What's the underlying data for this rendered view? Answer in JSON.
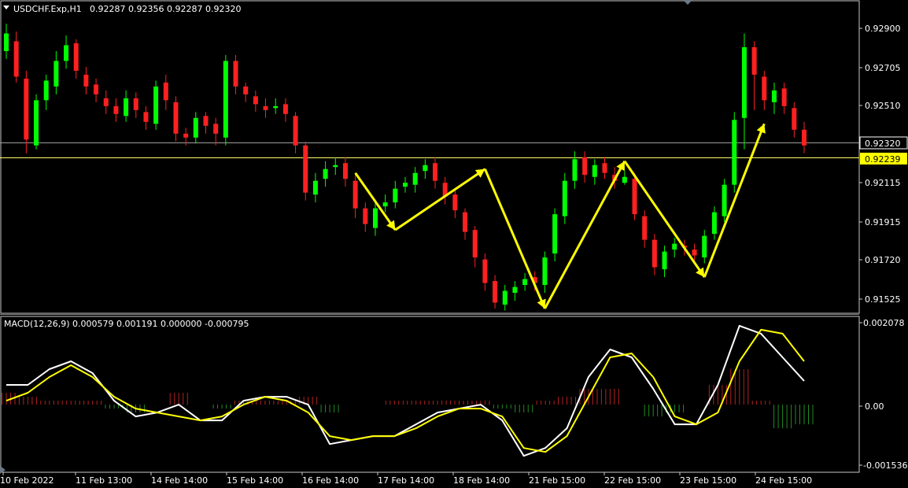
{
  "main_panel": {
    "symbol_label": "USDCHF.Exp,H1",
    "ohlc_label": "0.92287 0.92356 0.92287 0.92320",
    "price_ticks": [
      "0.92900",
      "0.92705",
      "0.92510",
      "0.92320",
      "0.92239",
      "0.92115",
      "0.91915",
      "0.91720",
      "0.91525"
    ],
    "current_price": "0.92320",
    "horizontal_line_price": "0.92239"
  },
  "macd_panel": {
    "indicator_label": "MACD(12,26,9) 0.000579 0.001191 0.000000 -0.000795",
    "scale_ticks": [
      "0.002078",
      "0.00",
      "-0.001536"
    ]
  },
  "time_axis": {
    "labels": [
      "10 Feb 2022",
      "11 Feb 13:00",
      "14 Feb 14:00",
      "15 Feb 14:00",
      "16 Feb 14:00",
      "17 Feb 14:00",
      "18 Feb 14:00",
      "21 Feb 15:00",
      "22 Feb 15:00",
      "23 Feb 15:00",
      "24 Feb 15:00"
    ]
  },
  "colors": {
    "background": "#000000",
    "bull_candle": "#00ff00",
    "bear_candle": "#ff2020",
    "arrow": "#ffff00",
    "macd_line": "#ffffff",
    "signal_line": "#ffff00",
    "hist_positive": "#b22222",
    "hist_negative": "#228b22",
    "current_price_line": "#9e9e9e",
    "horizontal_line": "#ffff66"
  },
  "chart_data": [
    {
      "type": "candlestick",
      "series": [
        {
          "name": "USDCHF.Exp,H1",
          "values": [
            0.9289,
            0.9267,
            0.9235,
            0.9255,
            0.9265,
            0.9275,
            0.9283,
            0.927,
            0.9262,
            0.9258,
            0.9252,
            0.9248,
            0.9256,
            0.925,
            0.9244,
            0.9262,
            0.9255,
            0.9238,
            0.9236,
            0.9246,
            0.9242,
            0.9238,
            0.9275,
            0.9262,
            0.9258,
            0.9253,
            0.925,
            0.9252,
            0.9248,
            0.9232,
            0.9208,
            0.9214,
            0.922,
            0.9222,
            0.9215,
            0.92,
            0.9192,
            0.92,
            0.9203,
            0.921,
            0.9213,
            0.9218,
            0.9222,
            0.9214,
            0.9206,
            0.9199,
            0.9188,
            0.9175,
            0.9162,
            0.9152,
            0.9158,
            0.916,
            0.9164,
            0.9162,
            0.9175,
            0.9197,
            0.9214,
            0.9225,
            0.9217,
            0.9222,
            0.9218,
            0.9214,
            0.9216,
            0.9197,
            0.9184,
            0.917,
            0.9178,
            0.9182,
            0.918,
            0.9176,
            0.9186,
            0.9198,
            0.9212,
            0.9245,
            0.9282,
            0.9268,
            0.9255,
            0.926,
            0.9252,
            0.924,
            0.9232
          ]
        }
      ],
      "candles": {
        "open": [
          0.928,
          0.9285,
          0.9266,
          0.9232,
          0.9255,
          0.9262,
          0.9275,
          0.9284,
          0.9268,
          0.9263,
          0.9256,
          0.9252,
          0.9247,
          0.9256,
          0.9249,
          0.9243,
          0.9264,
          0.9254,
          0.9238,
          0.9236,
          0.9247,
          0.9243,
          0.9236,
          0.9275,
          0.9262,
          0.9257,
          0.9252,
          0.9251,
          0.9253,
          0.9247,
          0.9232,
          0.9207,
          0.9215,
          0.9221,
          0.9223,
          0.9214,
          0.92,
          0.919,
          0.9201,
          0.9203,
          0.9211,
          0.9212,
          0.9219,
          0.9223,
          0.9213,
          0.9207,
          0.9198,
          0.9189,
          0.9174,
          0.9163,
          0.9151,
          0.9157,
          0.9161,
          0.9165,
          0.9161,
          0.9177,
          0.9196,
          0.9214,
          0.9226,
          0.9216,
          0.9223,
          0.9217,
          0.9213,
          0.9215,
          0.9196,
          0.9184,
          0.9169,
          0.9179,
          0.9181,
          0.9179,
          0.9175,
          0.9187,
          0.9196,
          0.9212,
          0.9246,
          0.9282,
          0.9267,
          0.9254,
          0.9261,
          0.9251,
          0.924
        ],
        "high": [
          0.9294,
          0.929,
          0.927,
          0.9258,
          0.9268,
          0.928,
          0.9288,
          0.9286,
          0.9272,
          0.9266,
          0.926,
          0.9256,
          0.926,
          0.9259,
          0.9252,
          0.9265,
          0.9268,
          0.9257,
          0.9241,
          0.9249,
          0.9249,
          0.9246,
          0.9278,
          0.9278,
          0.9264,
          0.926,
          0.9256,
          0.9256,
          0.9256,
          0.9249,
          0.9234,
          0.9218,
          0.9224,
          0.9226,
          0.9226,
          0.9217,
          0.9203,
          0.9203,
          0.9207,
          0.9214,
          0.9216,
          0.9221,
          0.9225,
          0.9226,
          0.9216,
          0.9209,
          0.92,
          0.9191,
          0.9177,
          0.9166,
          0.9161,
          0.9163,
          0.9167,
          0.9168,
          0.9178,
          0.92,
          0.9218,
          0.9229,
          0.9229,
          0.9225,
          0.9226,
          0.9221,
          0.9219,
          0.9218,
          0.9199,
          0.9187,
          0.9181,
          0.9185,
          0.9184,
          0.9182,
          0.9189,
          0.9201,
          0.9215,
          0.9249,
          0.9289,
          0.9285,
          0.927,
          0.9264,
          0.9264,
          0.9254,
          0.9244
        ],
        "low": [
          0.9276,
          0.9264,
          0.9228,
          0.923,
          0.925,
          0.9258,
          0.9271,
          0.9266,
          0.9258,
          0.9254,
          0.9248,
          0.9244,
          0.9244,
          0.9246,
          0.924,
          0.924,
          0.925,
          0.9234,
          0.9232,
          0.9233,
          0.9238,
          0.9232,
          0.9232,
          0.9258,
          0.9254,
          0.9249,
          0.9246,
          0.9248,
          0.9244,
          0.9228,
          0.9204,
          0.9203,
          0.9211,
          0.9217,
          0.9211,
          0.9195,
          0.9188,
          0.9186,
          0.9198,
          0.92,
          0.9208,
          0.9208,
          0.9215,
          0.921,
          0.9202,
          0.9195,
          0.9184,
          0.917,
          0.9158,
          0.9149,
          0.9148,
          0.9153,
          0.9158,
          0.9158,
          0.9157,
          0.9173,
          0.9192,
          0.921,
          0.9213,
          0.9212,
          0.9215,
          0.921,
          0.9212,
          0.9194,
          0.918,
          0.9166,
          0.9165,
          0.9175,
          0.9176,
          0.9173,
          0.9172,
          0.9184,
          0.9193,
          0.9208,
          0.923,
          0.925,
          0.925,
          0.9248,
          0.9248,
          0.9236,
          0.9228
        ],
        "close": [
          0.9289,
          0.9267,
          0.9235,
          0.9255,
          0.9265,
          0.9275,
          0.9283,
          0.927,
          0.9262,
          0.9258,
          0.9252,
          0.9248,
          0.9256,
          0.925,
          0.9244,
          0.9262,
          0.9255,
          0.9238,
          0.9236,
          0.9246,
          0.9242,
          0.9238,
          0.9275,
          0.9262,
          0.9258,
          0.9253,
          0.925,
          0.9252,
          0.9248,
          0.9232,
          0.9208,
          0.9214,
          0.922,
          0.9222,
          0.9215,
          0.92,
          0.9192,
          0.92,
          0.9203,
          0.921,
          0.9213,
          0.9218,
          0.9222,
          0.9214,
          0.9206,
          0.9199,
          0.9188,
          0.9175,
          0.9162,
          0.9152,
          0.9158,
          0.916,
          0.9164,
          0.9162,
          0.9175,
          0.9197,
          0.9214,
          0.9225,
          0.9217,
          0.9222,
          0.9218,
          0.9214,
          0.9216,
          0.9197,
          0.9184,
          0.917,
          0.9178,
          0.9182,
          0.918,
          0.9176,
          0.9186,
          0.9198,
          0.9212,
          0.9245,
          0.9282,
          0.9268,
          0.9255,
          0.926,
          0.9252,
          0.924,
          0.9232
        ]
      },
      "ylim": [
        0.9149,
        0.9298
      ],
      "arrows": [
        {
          "from": [
            35,
            0.9218
          ],
          "to": [
            39,
            0.9189
          ]
        },
        {
          "from": [
            39,
            0.9189
          ],
          "to": [
            48,
            0.922
          ]
        },
        {
          "from": [
            48,
            0.922
          ],
          "to": [
            54,
            0.9149
          ]
        },
        {
          "from": [
            54,
            0.9149
          ],
          "to": [
            62,
            0.9224
          ]
        },
        {
          "from": [
            62,
            0.9224
          ],
          "to": [
            70,
            0.9165
          ]
        },
        {
          "from": [
            70,
            0.9165
          ],
          "to": [
            76,
            0.9243
          ]
        }
      ],
      "grid": false
    },
    {
      "type": "line",
      "series": [
        {
          "name": "MACD",
          "values": [
            0.0005,
            0.0005,
            0.0009,
            0.0011,
            0.0008,
            0.0001,
            -0.0003,
            -0.0002,
            0.0,
            -0.0004,
            -0.0004,
            0.0001,
            0.0002,
            0.0002,
            0.0,
            -0.001,
            -0.0009,
            -0.0008,
            -0.0008,
            -0.0005,
            -0.0002,
            -0.0001,
            0.0,
            -0.0004,
            -0.0013,
            -0.0011,
            -0.0006,
            0.0007,
            0.0014,
            0.0012,
            0.0004,
            -0.0005,
            -0.0005,
            0.0005,
            0.002,
            0.0018,
            0.0012,
            0.0006
          ]
        },
        {
          "name": "Signal",
          "values": [
            0.0001,
            0.0003,
            0.0007,
            0.001,
            0.0007,
            0.0002,
            -0.0001,
            -0.0002,
            -0.0003,
            -0.0004,
            -0.0003,
            0.0,
            0.0002,
            0.0001,
            -0.0002,
            -0.0008,
            -0.0009,
            -0.0008,
            -0.0008,
            -0.0006,
            -0.0003,
            -0.0001,
            -0.0001,
            -0.0003,
            -0.0011,
            -0.0012,
            -0.0008,
            0.0002,
            0.0012,
            0.0013,
            0.0007,
            -0.0003,
            -0.0005,
            -0.0002,
            0.0011,
            0.0019,
            0.0018,
            0.0011
          ]
        }
      ],
      "histogram": [
        0.0003,
        0.0002,
        0.0001,
        0.0001,
        0.0001,
        -0.0001,
        -0.0002,
        0.0,
        0.0003,
        0.0,
        -0.0001,
        0.0001,
        0.0001,
        0.0001,
        0.0002,
        -0.0002,
        0.0,
        0.0,
        0.0001,
        0.0001,
        0.0001,
        0.0001,
        0.0001,
        -0.0001,
        -0.0002,
        0.0001,
        0.0002,
        0.0004,
        0.0004,
        0.0,
        -0.0003,
        -0.0002,
        0.0,
        0.0005,
        0.0009,
        0.0001,
        -0.0006,
        -0.0005
      ],
      "ylim": [
        -0.001536,
        0.002078
      ],
      "grid": false
    }
  ]
}
